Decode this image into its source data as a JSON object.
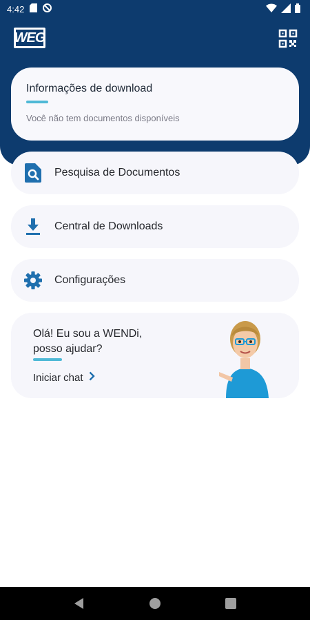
{
  "status_bar": {
    "time": "4:42"
  },
  "header": {
    "logo_text": "WEG"
  },
  "download_card": {
    "title": "Informações de download",
    "subtitle": "Você não tem documentos disponíveis"
  },
  "menu": [
    {
      "label": "Pesquisa de Documentos",
      "icon": "document-search-icon"
    },
    {
      "label": "Central de Downloads",
      "icon": "download-icon"
    },
    {
      "label": "Configurações",
      "icon": "gear-icon"
    }
  ],
  "assistant": {
    "greeting": "Olá! Eu sou a WENDi, posso ajudar?",
    "chat_label": "Iniciar chat"
  },
  "colors": {
    "brand": "#0d3b6e",
    "accent": "#4fb9d6",
    "icon": "#1f6fae"
  }
}
